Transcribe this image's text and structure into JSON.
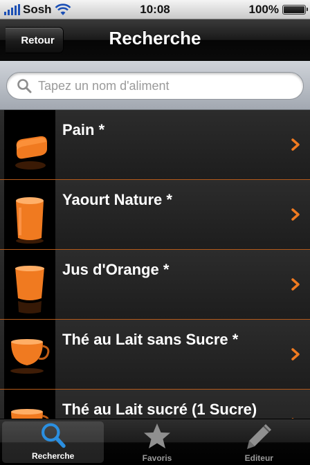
{
  "status_bar": {
    "carrier": "Sosh",
    "time": "10:08",
    "battery_percent": "100%"
  },
  "nav": {
    "back_label": "Retour",
    "title": "Recherche"
  },
  "search": {
    "placeholder": "Tapez un nom d'aliment",
    "value": ""
  },
  "items": [
    {
      "label": "Pain *",
      "image": "bread"
    },
    {
      "label": "Yaourt Nature *",
      "image": "yogurt"
    },
    {
      "label": "Jus d'Orange *",
      "image": "juice-glass"
    },
    {
      "label": "Thé au Lait sans Sucre *",
      "image": "tea-cup"
    },
    {
      "label": "Thé au Lait sucré (1 Sucre)",
      "image": "tea-cup"
    }
  ],
  "tabs": [
    {
      "label": "Recherche",
      "icon": "magnifier-icon",
      "active": true
    },
    {
      "label": "Favoris",
      "icon": "star-icon",
      "active": false
    },
    {
      "label": "Editeur",
      "icon": "pencil-icon",
      "active": false
    }
  ],
  "colors": {
    "accent": "#f07a20",
    "search_icon_blue": "#2b8fe0"
  }
}
